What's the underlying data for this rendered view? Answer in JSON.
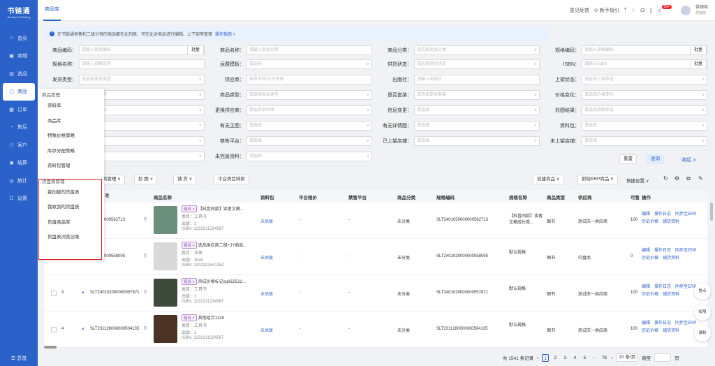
{
  "app": {
    "logo": "书链通",
    "logo_sub": "Shulian Publishing"
  },
  "nav": [
    {
      "label": "首页",
      "icon": "home-icon",
      "glyph": "⌂"
    },
    {
      "label": "商城",
      "icon": "shop-icon",
      "glyph": "▣"
    },
    {
      "label": "选品",
      "icon": "select-icon",
      "glyph": "▤"
    },
    {
      "label": "商品",
      "icon": "goods-icon",
      "glyph": "▢"
    },
    {
      "label": "订单",
      "icon": "order-icon",
      "glyph": "▦"
    },
    {
      "label": "售后",
      "icon": "aftersale-icon",
      "glyph": "◔"
    },
    {
      "label": "客户",
      "icon": "customer-icon",
      "glyph": "⚇"
    },
    {
      "label": "结算",
      "icon": "settle-icon",
      "glyph": "◉"
    },
    {
      "label": "统计",
      "icon": "stats-icon",
      "glyph": "◎"
    },
    {
      "label": "设置",
      "icon": "settings-icon",
      "glyph": "☷"
    }
  ],
  "nav_bottom": "☰ 总览",
  "topbar": {
    "tab": "商品库",
    "feedback": "意见反馈",
    "guide": "新手指引",
    "badge": "99+",
    "user": "供销商",
    "user_sub": "供销商"
  },
  "notice": {
    "text": "在书链通销售和二级分销的商品都在此列表，可在此对商品进行编辑、上下架等管理",
    "link": "操作指南 >"
  },
  "filters": [
    {
      "label": "商品编码：",
      "ph": "请输入商品编码",
      "suffix": "批量"
    },
    {
      "label": "商品名称：",
      "ph": "请输入商品名称"
    },
    {
      "label": "商品分类：",
      "ph": "请选择商品分类",
      "dd": true
    },
    {
      "label": "规格编码：",
      "ph": "请输入规格编码",
      "suffix": "批量"
    },
    {
      "label": "规格名称：",
      "ph": "请输入规格名称"
    },
    {
      "label": "运费模板：",
      "ph": "请选择",
      "dd": true
    },
    {
      "label": "供货状态：",
      "ph": "请选择供货状态",
      "dd": true
    },
    {
      "label": "ISBN：",
      "ph": "请输入ISBN",
      "suffix": "批量"
    },
    {
      "label": "发货类型：",
      "ph": "请选择发货类型",
      "dd": true
    },
    {
      "label": "供应商：",
      "ph": "账号名称/公司名称"
    },
    {
      "label": "出版社：",
      "ph": "请输入出版社"
    },
    {
      "label": "上架状态：",
      "ph": "请选择上架状态",
      "dd": true
    },
    {
      "label": "",
      "ph": "选择商品标签",
      "dd": true
    },
    {
      "label": "商品类型：",
      "ph": "请选择商品类型",
      "dd": true
    },
    {
      "label": "是否套装：",
      "ph": "请选择是否套装",
      "dd": true
    },
    {
      "label": "价格变化：",
      "ph": "请选择价格变化",
      "dd": true
    },
    {
      "label": "",
      "ph": "选择库存变化",
      "dd": true
    },
    {
      "label": "更换供应商：",
      "ph": "请选择供应商",
      "dd": true
    },
    {
      "label": "信息变更：",
      "ph": "请选择",
      "dd": true
    },
    {
      "label": "抓图结果：",
      "ph": "请选择抓图状态",
      "dd": true
    },
    {
      "label": "",
      "ph": "",
      "dd": true
    },
    {
      "label": "有无主图：",
      "ph": "请选择",
      "dd": true
    },
    {
      "label": "有无详情图：",
      "ph": "请选择",
      "dd": true
    },
    {
      "label": "资料包：",
      "ph": "请选择",
      "dd": true
    },
    {
      "label": "",
      "ph": "",
      "dd": true
    },
    {
      "label": "禁售平台：",
      "ph": "请选择",
      "dd": true
    },
    {
      "label": "已上架店铺：",
      "ph": "请选择",
      "dd": true
    },
    {
      "label": "未上架店铺：",
      "ph": "请选择",
      "dd": true
    },
    {
      "label": "",
      "ph": "",
      "dd": true
    },
    {
      "label": "未完善资料：",
      "ph": "请选择",
      "dd": true
    }
  ],
  "filter_actions": {
    "reset": "重置",
    "search": "查询",
    "collapse": "收起 ∧"
  },
  "toolbar": {
    "manage": "商管理 ∨",
    "grab": "抓 图 ∨",
    "shelf": "铺 货 ∨",
    "mapping": "平台类目映射",
    "create": "创建商品 ∨",
    "grab_erp": "抓取ERP商品 ∨",
    "quick": "快捷设置 ∨"
  },
  "columns": [
    "商品名称",
    "资料包",
    "平台限价",
    "禁售平台",
    "商品分类",
    "规格编码",
    "规格名称",
    "商品类型",
    "供应商",
    "可售",
    "操作"
  ],
  "rows": [
    {
      "idx": "",
      "code": "105000000562713",
      "tag": "组合 >",
      "name": "【抖音同款】读者文摘...",
      "l1": "类目：工具书",
      "l2": "出版：1",
      "l3": "ISBN: 1233211234567",
      "pkg": "未关联",
      "limit": "-",
      "ban": "-",
      "cat": "未分类",
      "sku": "SLT2401050000000562713",
      "skuname": "【抖音同款】读者文摘成长卷...",
      "type": "图书",
      "vendor": "测试庆一供应商",
      "stock": "100",
      "img": "#6a8f7a"
    },
    {
      "idx": "",
      "code": "102000000558095",
      "tag": "组合 >",
      "name": "选品供应商二级+JY商品...",
      "l1": "类目：法律",
      "l2": "出版：zhon",
      "l3": "ISBN: 1202203441352",
      "pkg": "未关联",
      "limit": "-",
      "ban": "-",
      "cat": "未分类",
      "sku": "SLT2401020000000558095",
      "skuname": "默认规格",
      "type": "图书",
      "vendor": "中盘商",
      "stock": "0",
      "img": "#d9d9d9"
    },
    {
      "idx": "3",
      "code": "SLT240102000000557871",
      "tag": "组合 >",
      "name": "测试价格标记spjk52512...",
      "l1": "类目：工具书",
      "l2": "出版：1",
      "l3": "ISBN: 1233211234567",
      "pkg": "未关联",
      "limit": "-",
      "ban": "-",
      "cat": "未分类",
      "sku": "SLT2401020000000557871",
      "skuname": "默认规格",
      "type": "图书",
      "vendor": "测试庆一供应商",
      "stock": "100",
      "img": "#3c4a3a"
    },
    {
      "idx": "4",
      "code": "SLT231128000000504135",
      "tag": "组合 >",
      "name": "其他组合1128",
      "l1": "类目：工具书",
      "l2": "出版：1",
      "l3": "ISBN: 1233211234567",
      "pkg": "未关联",
      "limit": "-",
      "ban": "-",
      "cat": "未分类",
      "sku": "SLT2311280000000504135",
      "skuname": "默认规格",
      "type": "图书",
      "vendor": "测试庆一供应商",
      "stock": "100",
      "img": "#4a3322"
    }
  ],
  "ops": {
    "edit": "编辑",
    "log": "操作日志",
    "sync": "同步至ERP",
    "price": "历史价格",
    "pkg": "铺货资料"
  },
  "submenu": {
    "group1": "商品管理",
    "items1": [
      "资料库",
      "商品库",
      "特殊价格策略",
      "库存分配策略",
      "资料包管理"
    ],
    "group2": "货盘表管理",
    "items2": [
      "我创建的货盘表",
      "我收到的货盘表",
      "货盘商品库",
      "货盘表浏览记录"
    ]
  },
  "pager": {
    "total": "共 1541 条记录",
    "pages": [
      "1",
      "2",
      "3",
      "4",
      "5",
      "···",
      "78"
    ],
    "size": "20 条/页",
    "goto": "跳至",
    "page_unit": "页"
  },
  "floats": [
    "提点",
    "权限",
    "录制"
  ]
}
